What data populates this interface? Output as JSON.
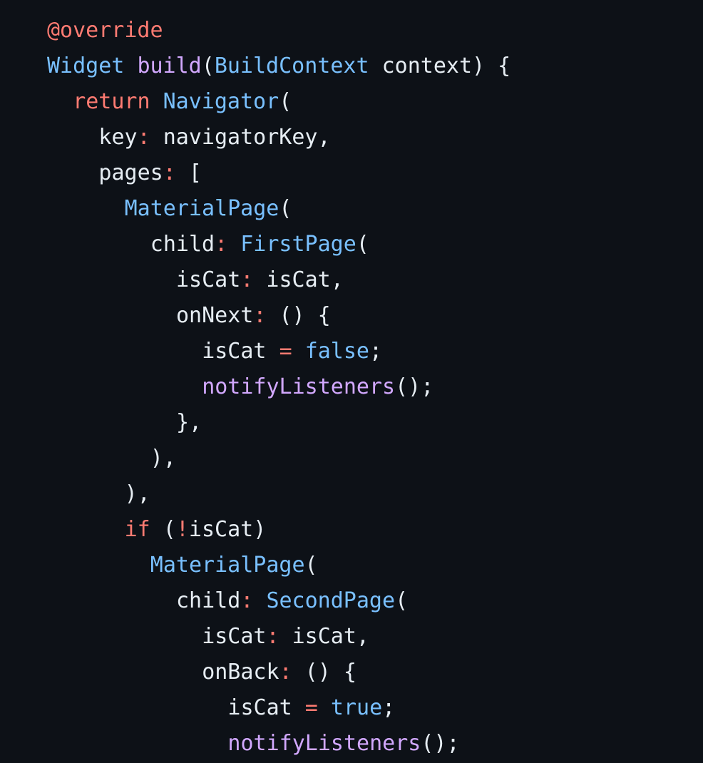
{
  "theme": {
    "background": "#0d1117",
    "text": "#e6edf3",
    "keyword": "#ff7b72",
    "type": "#79c0ff",
    "function": "#d2a8ff",
    "literal": "#79c0ff"
  },
  "code": {
    "lines": [
      {
        "indent": 0,
        "tokens": [
          {
            "t": "keyword",
            "v": "@override"
          }
        ]
      },
      {
        "indent": 0,
        "tokens": [
          {
            "t": "type",
            "v": "Widget"
          },
          {
            "t": "punct",
            "v": " "
          },
          {
            "t": "func",
            "v": "build"
          },
          {
            "t": "punct",
            "v": "("
          },
          {
            "t": "type",
            "v": "BuildContext"
          },
          {
            "t": "punct",
            "v": " context) {"
          }
        ]
      },
      {
        "indent": 2,
        "tokens": [
          {
            "t": "keyword",
            "v": "return"
          },
          {
            "t": "punct",
            "v": " "
          },
          {
            "t": "type",
            "v": "Navigator"
          },
          {
            "t": "punct",
            "v": "("
          }
        ]
      },
      {
        "indent": 4,
        "tokens": [
          {
            "t": "var",
            "v": "key"
          },
          {
            "t": "op",
            "v": ":"
          },
          {
            "t": "punct",
            "v": " navigatorKey,"
          }
        ]
      },
      {
        "indent": 4,
        "tokens": [
          {
            "t": "var",
            "v": "pages"
          },
          {
            "t": "op",
            "v": ":"
          },
          {
            "t": "punct",
            "v": " ["
          }
        ]
      },
      {
        "indent": 6,
        "tokens": [
          {
            "t": "type",
            "v": "MaterialPage"
          },
          {
            "t": "punct",
            "v": "("
          }
        ]
      },
      {
        "indent": 8,
        "tokens": [
          {
            "t": "var",
            "v": "child"
          },
          {
            "t": "op",
            "v": ":"
          },
          {
            "t": "punct",
            "v": " "
          },
          {
            "t": "type",
            "v": "FirstPage"
          },
          {
            "t": "punct",
            "v": "("
          }
        ]
      },
      {
        "indent": 10,
        "tokens": [
          {
            "t": "var",
            "v": "isCat"
          },
          {
            "t": "op",
            "v": ":"
          },
          {
            "t": "punct",
            "v": " isCat,"
          }
        ]
      },
      {
        "indent": 10,
        "tokens": [
          {
            "t": "var",
            "v": "onNext"
          },
          {
            "t": "op",
            "v": ":"
          },
          {
            "t": "punct",
            "v": " () {"
          }
        ]
      },
      {
        "indent": 12,
        "tokens": [
          {
            "t": "var",
            "v": "isCat"
          },
          {
            "t": "punct",
            "v": " "
          },
          {
            "t": "op",
            "v": "="
          },
          {
            "t": "punct",
            "v": " "
          },
          {
            "t": "literal",
            "v": "false"
          },
          {
            "t": "punct",
            "v": ";"
          }
        ]
      },
      {
        "indent": 12,
        "tokens": [
          {
            "t": "func",
            "v": "notifyListeners"
          },
          {
            "t": "punct",
            "v": "();"
          }
        ]
      },
      {
        "indent": 10,
        "tokens": [
          {
            "t": "punct",
            "v": "},"
          }
        ]
      },
      {
        "indent": 8,
        "tokens": [
          {
            "t": "punct",
            "v": "),"
          }
        ]
      },
      {
        "indent": 6,
        "tokens": [
          {
            "t": "punct",
            "v": "),"
          }
        ]
      },
      {
        "indent": 6,
        "tokens": [
          {
            "t": "keyword",
            "v": "if"
          },
          {
            "t": "punct",
            "v": " ("
          },
          {
            "t": "op",
            "v": "!"
          },
          {
            "t": "punct",
            "v": "isCat)"
          }
        ]
      },
      {
        "indent": 8,
        "tokens": [
          {
            "t": "type",
            "v": "MaterialPage"
          },
          {
            "t": "punct",
            "v": "("
          }
        ]
      },
      {
        "indent": 10,
        "tokens": [
          {
            "t": "var",
            "v": "child"
          },
          {
            "t": "op",
            "v": ":"
          },
          {
            "t": "punct",
            "v": " "
          },
          {
            "t": "type",
            "v": "SecondPage"
          },
          {
            "t": "punct",
            "v": "("
          }
        ]
      },
      {
        "indent": 12,
        "tokens": [
          {
            "t": "var",
            "v": "isCat"
          },
          {
            "t": "op",
            "v": ":"
          },
          {
            "t": "punct",
            "v": " isCat,"
          }
        ]
      },
      {
        "indent": 12,
        "tokens": [
          {
            "t": "var",
            "v": "onBack"
          },
          {
            "t": "op",
            "v": ":"
          },
          {
            "t": "punct",
            "v": " () {"
          }
        ]
      },
      {
        "indent": 14,
        "tokens": [
          {
            "t": "var",
            "v": "isCat"
          },
          {
            "t": "punct",
            "v": " "
          },
          {
            "t": "op",
            "v": "="
          },
          {
            "t": "punct",
            "v": " "
          },
          {
            "t": "literal",
            "v": "true"
          },
          {
            "t": "punct",
            "v": ";"
          }
        ]
      },
      {
        "indent": 14,
        "tokens": [
          {
            "t": "func",
            "v": "notifyListeners"
          },
          {
            "t": "punct",
            "v": "();"
          }
        ]
      }
    ]
  }
}
